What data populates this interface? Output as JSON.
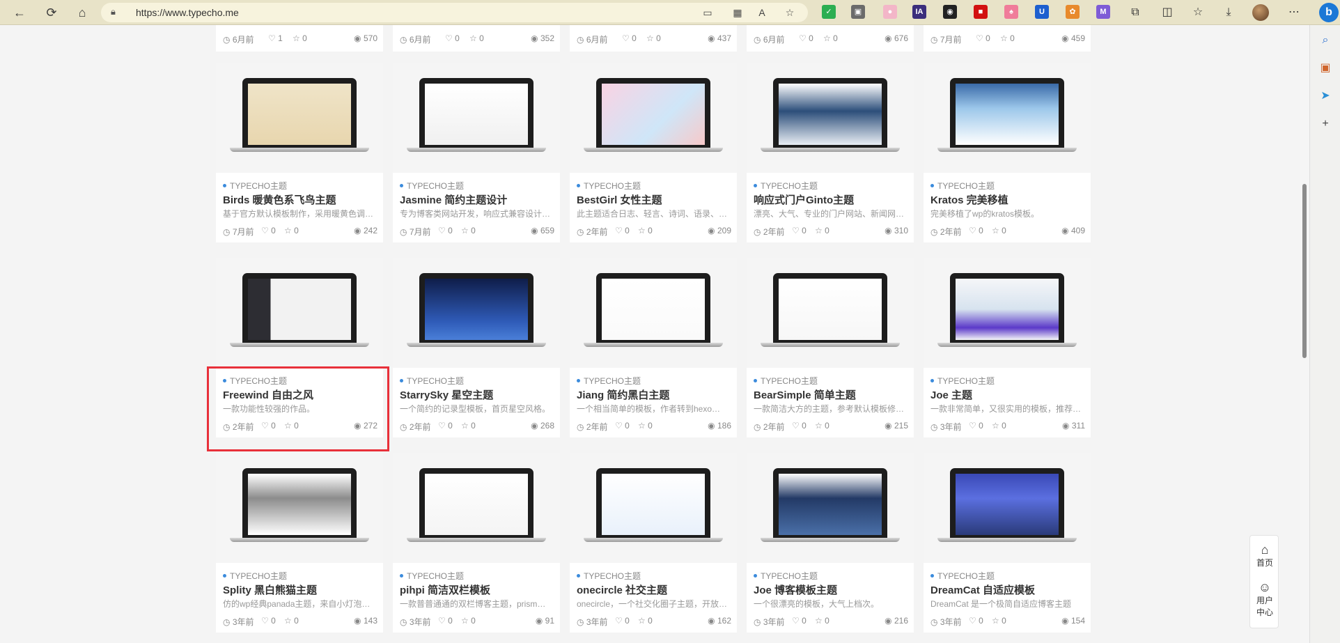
{
  "browser": {
    "url": "https://www.typecho.me",
    "back_icon": "arrow-left-icon",
    "refresh_icon": "refresh-icon",
    "home_icon": "home-icon"
  },
  "floating_nav": {
    "home_label": "首页",
    "user_center_line1": "用户",
    "user_center_line2": "中心"
  },
  "top_row": [
    {
      "time": "6月前",
      "likes": "1",
      "stars": "0",
      "views": "570"
    },
    {
      "time": "6月前",
      "likes": "0",
      "stars": "0",
      "views": "352"
    },
    {
      "time": "6月前",
      "likes": "0",
      "stars": "0",
      "views": "437"
    },
    {
      "time": "6月前",
      "likes": "0",
      "stars": "0",
      "views": "676"
    },
    {
      "time": "7月前",
      "likes": "0",
      "stars": "0",
      "views": "459"
    }
  ],
  "cards": [
    {
      "category": "TYPECHO主题",
      "title": "Birds 暖黄色系飞鸟主题",
      "desc": "基于官方默认模板制作，采用暖黄色调…",
      "time": "7月前",
      "likes": "0",
      "stars": "0",
      "views": "242"
    },
    {
      "category": "TYPECHO主题",
      "title": "Jasmine 简约主题设计",
      "desc": "专为博客类网站开发，响应式兼容设计…",
      "time": "7月前",
      "likes": "0",
      "stars": "0",
      "views": "659"
    },
    {
      "category": "TYPECHO主题",
      "title": "BestGirl 女性主题",
      "desc": "此主题适合日志、轻言、诗词、语录、…",
      "time": "2年前",
      "likes": "0",
      "stars": "0",
      "views": "209"
    },
    {
      "category": "TYPECHO主题",
      "title": "响应式门户Ginto主题",
      "desc": "漂亮、大气、专业的门户网站、新闻网…",
      "time": "2年前",
      "likes": "0",
      "stars": "0",
      "views": "310"
    },
    {
      "category": "TYPECHO主题",
      "title": "Kratos 完美移植",
      "desc": "完美移植了wp的kratos模板。",
      "time": "2年前",
      "likes": "0",
      "stars": "0",
      "views": "409"
    },
    {
      "category": "TYPECHO主题",
      "title": "Freewind 自由之风",
      "desc": "一款功能性较强的作品。",
      "time": "2年前",
      "likes": "0",
      "stars": "0",
      "views": "272"
    },
    {
      "category": "TYPECHO主题",
      "title": "StarrySky 星空主题",
      "desc": "一个简约的记录型模板，首页星空风格。",
      "time": "2年前",
      "likes": "0",
      "stars": "0",
      "views": "268"
    },
    {
      "category": "TYPECHO主题",
      "title": "Jiang 简约黑白主题",
      "desc": "一个相当简单的模板，作者转到hexo…",
      "time": "2年前",
      "likes": "0",
      "stars": "0",
      "views": "186"
    },
    {
      "category": "TYPECHO主题",
      "title": "BearSimple 简单主题",
      "desc": "一款简洁大方的主题，参考默认模板修…",
      "time": "2年前",
      "likes": "0",
      "stars": "0",
      "views": "215"
    },
    {
      "category": "TYPECHO主题",
      "title": "Joe 主题",
      "desc": "一款非常简单，又很实用的模板，推荐…",
      "time": "3年前",
      "likes": "0",
      "stars": "0",
      "views": "311"
    },
    {
      "category": "TYPECHO主题",
      "title": "Splity 黑白熊猫主题",
      "desc": "仿的wp经典panada主题，来自小灯泡…",
      "time": "3年前",
      "likes": "0",
      "stars": "0",
      "views": "143"
    },
    {
      "category": "TYPECHO主题",
      "title": "pihpi 简洁双栏模板",
      "desc": "一款普普通通的双栏博客主题，prism…",
      "time": "3年前",
      "likes": "0",
      "stars": "0",
      "views": "91"
    },
    {
      "category": "TYPECHO主题",
      "title": "onecircle 社交主题",
      "desc": "onecircle，一个社交化圈子主题，开放…",
      "time": "3年前",
      "likes": "0",
      "stars": "0",
      "views": "162"
    },
    {
      "category": "TYPECHO主题",
      "title": "Joe 博客模板主题",
      "desc": "一个很漂亮的模板，大气上档次。",
      "time": "3年前",
      "likes": "0",
      "stars": "0",
      "views": "216"
    },
    {
      "category": "TYPECHO主题",
      "title": "DreamCat 自适应模板",
      "desc": "DreamCat 是一个极简自适应博客主题",
      "time": "3年前",
      "likes": "0",
      "stars": "0",
      "views": "154"
    }
  ],
  "colors": {
    "accent_dot": "#3b8bdc",
    "highlight_border": "#e8303a"
  }
}
